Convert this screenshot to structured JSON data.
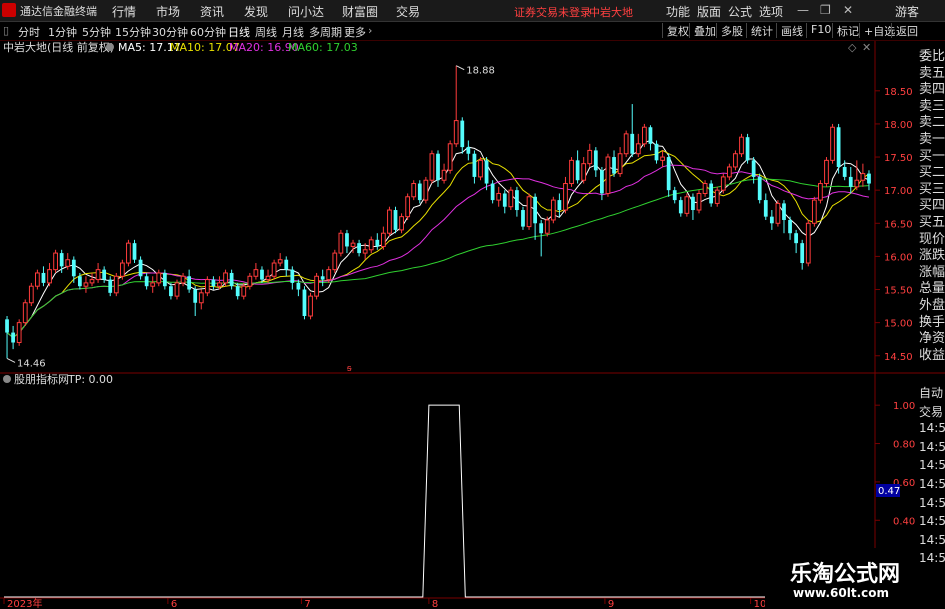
{
  "app": {
    "name": "通达信金融终端",
    "menus": [
      "行情",
      "市场",
      "资讯",
      "发现",
      "问小达",
      "财富圈",
      "交易"
    ],
    "right_menus": [
      "功能",
      "版面",
      "公式",
      "选项"
    ],
    "warning": "证券交易未登录",
    "stock_name": "中岩大地",
    "skin": "游客"
  },
  "periods": [
    "分时",
    "1分钟",
    "5分钟",
    "15分钟",
    "30分钟",
    "60分钟",
    "日线",
    "周线",
    "月线",
    "多周期",
    "更多"
  ],
  "active_period": "日线",
  "right_tools": [
    "复权",
    "叠加",
    "多股",
    "统计",
    "画线",
    "F10",
    "标记",
    "+自选",
    "返回"
  ],
  "main_title": "中岩大地(日线 前复权)",
  "ma": [
    {
      "name": "MA5",
      "value": "17.17",
      "color": "#ffffff"
    },
    {
      "name": "MA10",
      "value": "17.07",
      "color": "#e8e000"
    },
    {
      "name": "MA20",
      "value": "16.90",
      "color": "#e030e0"
    },
    {
      "name": "MA60",
      "value": "17.03",
      "color": "#30d030"
    }
  ],
  "ind_title": "股朋指标网",
  "ind_value": "TP: 0.00",
  "side_labels": [
    "委比",
    "卖五",
    "卖四",
    "卖三",
    "卖二",
    "卖一",
    "买一",
    "买二",
    "买三",
    "买四",
    "买五",
    "现价",
    "涨跌",
    "涨幅",
    "总量",
    "外盘",
    "换手",
    "净资",
    "收益"
  ],
  "side_labels2": [
    "自动",
    "交易",
    "14:56",
    "14:56",
    "14:56",
    "14:56",
    "14:56",
    "14:56",
    "14:56",
    "14:56"
  ],
  "price_axis": [
    "18.50",
    "18.00",
    "17.50",
    "17.00",
    "16.50",
    "16.00",
    "15.50",
    "15.00",
    "14.50"
  ],
  "ind_axis": [
    "1.00",
    "0.80",
    "0.60",
    "0.40",
    "0.20"
  ],
  "ind_current": "0.47",
  "high_label": "18.88",
  "low_label": "14.46",
  "date_labels": [
    "2023年",
    "6",
    "7",
    "8",
    "9",
    "10"
  ],
  "watermark": {
    "line1": "乐淘公式网",
    "line2": "www.60lt.com"
  },
  "chart_data": {
    "type": "candlestick",
    "ylim": [
      14.3,
      18.95
    ],
    "candles": [
      [
        15.05,
        14.85,
        15.1,
        14.46
      ],
      [
        14.85,
        14.7,
        14.95,
        14.6
      ],
      [
        14.7,
        15.0,
        15.05,
        14.65
      ],
      [
        15.0,
        15.3,
        15.35,
        14.95
      ],
      [
        15.3,
        15.55,
        15.6,
        15.25
      ],
      [
        15.55,
        15.75,
        15.8,
        15.5
      ],
      [
        15.75,
        15.6,
        15.85,
        15.55
      ],
      [
        15.6,
        15.8,
        15.9,
        15.55
      ],
      [
        15.8,
        16.05,
        16.1,
        15.75
      ],
      [
        16.05,
        15.85,
        16.1,
        15.75
      ],
      [
        15.85,
        15.95,
        16.05,
        15.8
      ],
      [
        15.95,
        15.7,
        16.0,
        15.6
      ],
      [
        15.7,
        15.55,
        15.75,
        15.5
      ],
      [
        15.55,
        15.6,
        15.7,
        15.45
      ],
      [
        15.6,
        15.65,
        15.75,
        15.55
      ],
      [
        15.65,
        15.8,
        15.9,
        15.6
      ],
      [
        15.8,
        15.65,
        15.85,
        15.6
      ],
      [
        15.65,
        15.45,
        15.7,
        15.4
      ],
      [
        15.45,
        15.7,
        15.75,
        15.4
      ],
      [
        15.7,
        15.9,
        15.95,
        15.65
      ],
      [
        15.9,
        16.2,
        16.25,
        15.85
      ],
      [
        16.2,
        15.95,
        16.25,
        15.9
      ],
      [
        15.95,
        15.7,
        16.0,
        15.65
      ],
      [
        15.7,
        15.55,
        15.75,
        15.5
      ],
      [
        15.55,
        15.6,
        15.7,
        15.45
      ],
      [
        15.6,
        15.75,
        15.8,
        15.55
      ],
      [
        15.75,
        15.55,
        15.8,
        15.5
      ],
      [
        15.55,
        15.4,
        15.6,
        15.35
      ],
      [
        15.4,
        15.6,
        15.65,
        15.35
      ],
      [
        15.6,
        15.7,
        15.75,
        15.55
      ],
      [
        15.7,
        15.5,
        15.8,
        15.45
      ],
      [
        15.5,
        15.3,
        15.55,
        15.1
      ],
      [
        15.3,
        15.45,
        15.5,
        15.2
      ],
      [
        15.45,
        15.65,
        15.7,
        15.4
      ],
      [
        15.65,
        15.55,
        15.7,
        15.5
      ],
      [
        15.55,
        15.6,
        15.7,
        15.5
      ],
      [
        15.6,
        15.75,
        15.8,
        15.55
      ],
      [
        15.75,
        15.55,
        15.8,
        15.5
      ],
      [
        15.55,
        15.4,
        15.6,
        15.35
      ],
      [
        15.4,
        15.55,
        15.6,
        15.35
      ],
      [
        15.55,
        15.7,
        15.75,
        15.5
      ],
      [
        15.7,
        15.8,
        15.9,
        15.65
      ],
      [
        15.8,
        15.65,
        15.85,
        15.6
      ],
      [
        15.65,
        15.7,
        15.8,
        15.6
      ],
      [
        15.7,
        15.9,
        15.95,
        15.65
      ],
      [
        15.9,
        15.95,
        16.05,
        15.85
      ],
      [
        15.95,
        15.8,
        16.0,
        15.7
      ],
      [
        15.8,
        15.6,
        15.85,
        15.5
      ],
      [
        15.6,
        15.5,
        15.65,
        15.4
      ],
      [
        15.5,
        15.1,
        15.55,
        15.05
      ],
      [
        15.1,
        15.4,
        15.45,
        15.05
      ],
      [
        15.4,
        15.7,
        15.75,
        15.35
      ],
      [
        15.7,
        15.65,
        15.8,
        15.55
      ],
      [
        15.65,
        15.8,
        15.85,
        15.6
      ],
      [
        15.8,
        16.05,
        16.1,
        15.75
      ],
      [
        16.05,
        16.35,
        16.4,
        16.0
      ],
      [
        16.35,
        16.15,
        16.4,
        16.05
      ],
      [
        16.15,
        16.2,
        16.25,
        16.05
      ],
      [
        16.2,
        16.05,
        16.25,
        16.0
      ],
      [
        16.05,
        16.1,
        16.2,
        15.95
      ],
      [
        16.1,
        16.25,
        16.3,
        16.05
      ],
      [
        16.25,
        16.15,
        16.35,
        16.1
      ],
      [
        16.15,
        16.35,
        16.45,
        16.1
      ],
      [
        16.35,
        16.7,
        16.75,
        16.3
      ],
      [
        16.7,
        16.4,
        16.75,
        16.35
      ],
      [
        16.4,
        16.6,
        16.65,
        16.35
      ],
      [
        16.6,
        16.9,
        16.95,
        16.55
      ],
      [
        16.9,
        17.1,
        17.15,
        16.85
      ],
      [
        17.1,
        16.85,
        17.15,
        16.8
      ],
      [
        16.85,
        17.15,
        17.2,
        16.8
      ],
      [
        17.15,
        17.55,
        17.6,
        17.1
      ],
      [
        17.55,
        17.15,
        17.6,
        17.05
      ],
      [
        17.15,
        17.3,
        17.4,
        17.1
      ],
      [
        17.3,
        17.7,
        17.75,
        17.25
      ],
      [
        17.7,
        18.05,
        18.88,
        17.65
      ],
      [
        18.05,
        17.65,
        18.1,
        17.55
      ],
      [
        17.65,
        17.55,
        17.75,
        17.45
      ],
      [
        17.55,
        17.2,
        17.6,
        17.1
      ],
      [
        17.2,
        17.45,
        17.5,
        17.15
      ],
      [
        17.45,
        17.1,
        17.5,
        17.0
      ],
      [
        17.1,
        16.85,
        17.15,
        16.8
      ],
      [
        16.85,
        16.95,
        17.05,
        16.75
      ],
      [
        16.95,
        16.75,
        17.0,
        16.65
      ],
      [
        16.75,
        17.0,
        17.05,
        16.7
      ],
      [
        17.0,
        16.7,
        17.05,
        16.6
      ],
      [
        16.7,
        16.45,
        16.75,
        16.4
      ],
      [
        16.45,
        16.9,
        16.95,
        16.4
      ],
      [
        16.9,
        16.5,
        16.95,
        16.25
      ],
      [
        16.5,
        16.35,
        16.55,
        16.0
      ],
      [
        16.35,
        16.55,
        16.6,
        16.3
      ],
      [
        16.55,
        16.85,
        16.9,
        16.5
      ],
      [
        16.85,
        16.7,
        16.95,
        16.6
      ],
      [
        16.7,
        17.1,
        17.2,
        16.65
      ],
      [
        17.1,
        17.45,
        17.5,
        17.05
      ],
      [
        17.45,
        17.15,
        17.6,
        17.1
      ],
      [
        17.15,
        17.4,
        17.5,
        17.1
      ],
      [
        17.4,
        17.6,
        17.7,
        17.35
      ],
      [
        17.6,
        17.3,
        17.65,
        17.2
      ],
      [
        17.3,
        16.95,
        17.35,
        16.85
      ],
      [
        16.95,
        17.5,
        17.55,
        16.9
      ],
      [
        17.5,
        17.25,
        17.6,
        17.2
      ],
      [
        17.25,
        17.55,
        17.65,
        17.2
      ],
      [
        17.55,
        17.85,
        17.9,
        17.5
      ],
      [
        17.85,
        17.55,
        18.3,
        17.5
      ],
      [
        17.55,
        17.7,
        17.85,
        17.5
      ],
      [
        17.7,
        17.95,
        18.0,
        17.65
      ],
      [
        17.95,
        17.7,
        17.98,
        17.6
      ],
      [
        17.7,
        17.45,
        17.75,
        17.4
      ],
      [
        17.45,
        17.5,
        17.6,
        17.35
      ],
      [
        17.5,
        17.0,
        17.55,
        16.9
      ],
      [
        17.0,
        16.85,
        17.05,
        16.8
      ],
      [
        16.85,
        16.65,
        16.9,
        16.6
      ],
      [
        16.65,
        16.9,
        16.95,
        16.6
      ],
      [
        16.9,
        16.7,
        16.95,
        16.55
      ],
      [
        16.7,
        16.95,
        17.0,
        16.65
      ],
      [
        16.95,
        17.1,
        17.15,
        16.9
      ],
      [
        17.1,
        16.8,
        17.15,
        16.75
      ],
      [
        16.8,
        17.0,
        17.05,
        16.75
      ],
      [
        17.0,
        17.2,
        17.25,
        16.95
      ],
      [
        17.2,
        17.35,
        17.4,
        17.15
      ],
      [
        17.35,
        17.55,
        17.6,
        17.3
      ],
      [
        17.55,
        17.8,
        17.85,
        17.5
      ],
      [
        17.8,
        17.45,
        17.85,
        17.4
      ],
      [
        17.45,
        17.2,
        17.5,
        17.1
      ],
      [
        17.2,
        16.85,
        17.25,
        16.8
      ],
      [
        16.85,
        16.6,
        16.95,
        16.55
      ],
      [
        16.6,
        16.5,
        16.7,
        16.4
      ],
      [
        16.5,
        16.8,
        16.85,
        16.45
      ],
      [
        16.8,
        16.55,
        16.85,
        16.35
      ],
      [
        16.55,
        16.35,
        16.6,
        16.25
      ],
      [
        16.35,
        16.2,
        16.4,
        16.05
      ],
      [
        16.2,
        15.9,
        16.25,
        15.8
      ],
      [
        15.9,
        16.5,
        16.55,
        15.85
      ],
      [
        16.5,
        16.85,
        16.9,
        16.45
      ],
      [
        16.85,
        17.1,
        17.15,
        16.8
      ],
      [
        17.1,
        17.45,
        17.5,
        17.05
      ],
      [
        17.45,
        17.95,
        18.0,
        17.4
      ],
      [
        17.95,
        17.35,
        18.0,
        17.25
      ],
      [
        17.35,
        17.2,
        17.45,
        17.15
      ],
      [
        17.2,
        17.05,
        17.35,
        16.95
      ],
      [
        17.05,
        17.15,
        17.45,
        17.0
      ],
      [
        17.15,
        17.25,
        17.4,
        17.05
      ],
      [
        17.25,
        17.1,
        17.3,
        17.0
      ]
    ],
    "indicator": {
      "name": "TP",
      "ylim": [
        0,
        1.1
      ],
      "high_from": 69,
      "high_to": 76,
      "current": 0.0
    }
  }
}
